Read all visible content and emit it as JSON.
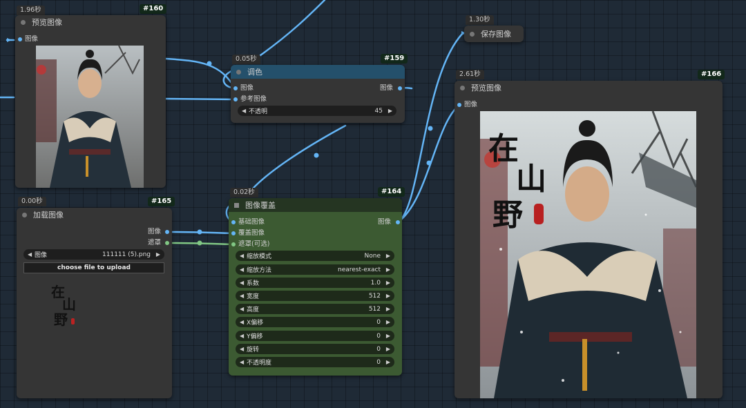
{
  "nodes": {
    "n160": {
      "id": "#160",
      "time": "1.96秒",
      "title": "预览图像",
      "input": "图像"
    },
    "n159": {
      "id": "#159",
      "time": "0.05秒",
      "title": "调色",
      "inputs": [
        "图像",
        "参考图像"
      ],
      "output": "图像",
      "widget": {
        "label": "不透明",
        "value": "45"
      }
    },
    "n165": {
      "id": "#165",
      "time": "0.00秒",
      "title": "加载图像",
      "outputs": [
        "图像",
        "遮罩"
      ],
      "widget": {
        "label": "图像",
        "value": "111111 (5).png"
      },
      "upload_label": "choose file to upload",
      "thumb_text": [
        "在",
        "山",
        "野"
      ]
    },
    "n164": {
      "id": "#164",
      "time": "0.02秒",
      "title": "图像覆盖",
      "inputs": [
        "基础图像",
        "覆盖图像",
        "遮罩(可选)"
      ],
      "output": "图像",
      "widgets": [
        {
          "label": "缩放模式",
          "value": "None"
        },
        {
          "label": "缩放方法",
          "value": "nearest-exact"
        },
        {
          "label": "系数",
          "value": "1.0"
        },
        {
          "label": "宽度",
          "value": "512"
        },
        {
          "label": "高度",
          "value": "512"
        },
        {
          "label": "X偏移",
          "value": "0"
        },
        {
          "label": "Y偏移",
          "value": "0"
        },
        {
          "label": "旋转",
          "value": "0"
        },
        {
          "label": "不透明度",
          "value": "0"
        }
      ]
    },
    "n_save": {
      "time": "1.30秒",
      "title": "保存图像"
    },
    "n166": {
      "id": "#166",
      "time": "2.61秒",
      "title": "预览图像",
      "input": "图像",
      "calligraphy": [
        "在",
        "山",
        "野"
      ]
    }
  },
  "colors": {
    "canvas": "#1f2a36",
    "node": "#353535",
    "wire_image": "#64b5f6",
    "wire_mask": "#81c784",
    "header_blue": "#24506b",
    "node_green": "#3c5a32"
  }
}
